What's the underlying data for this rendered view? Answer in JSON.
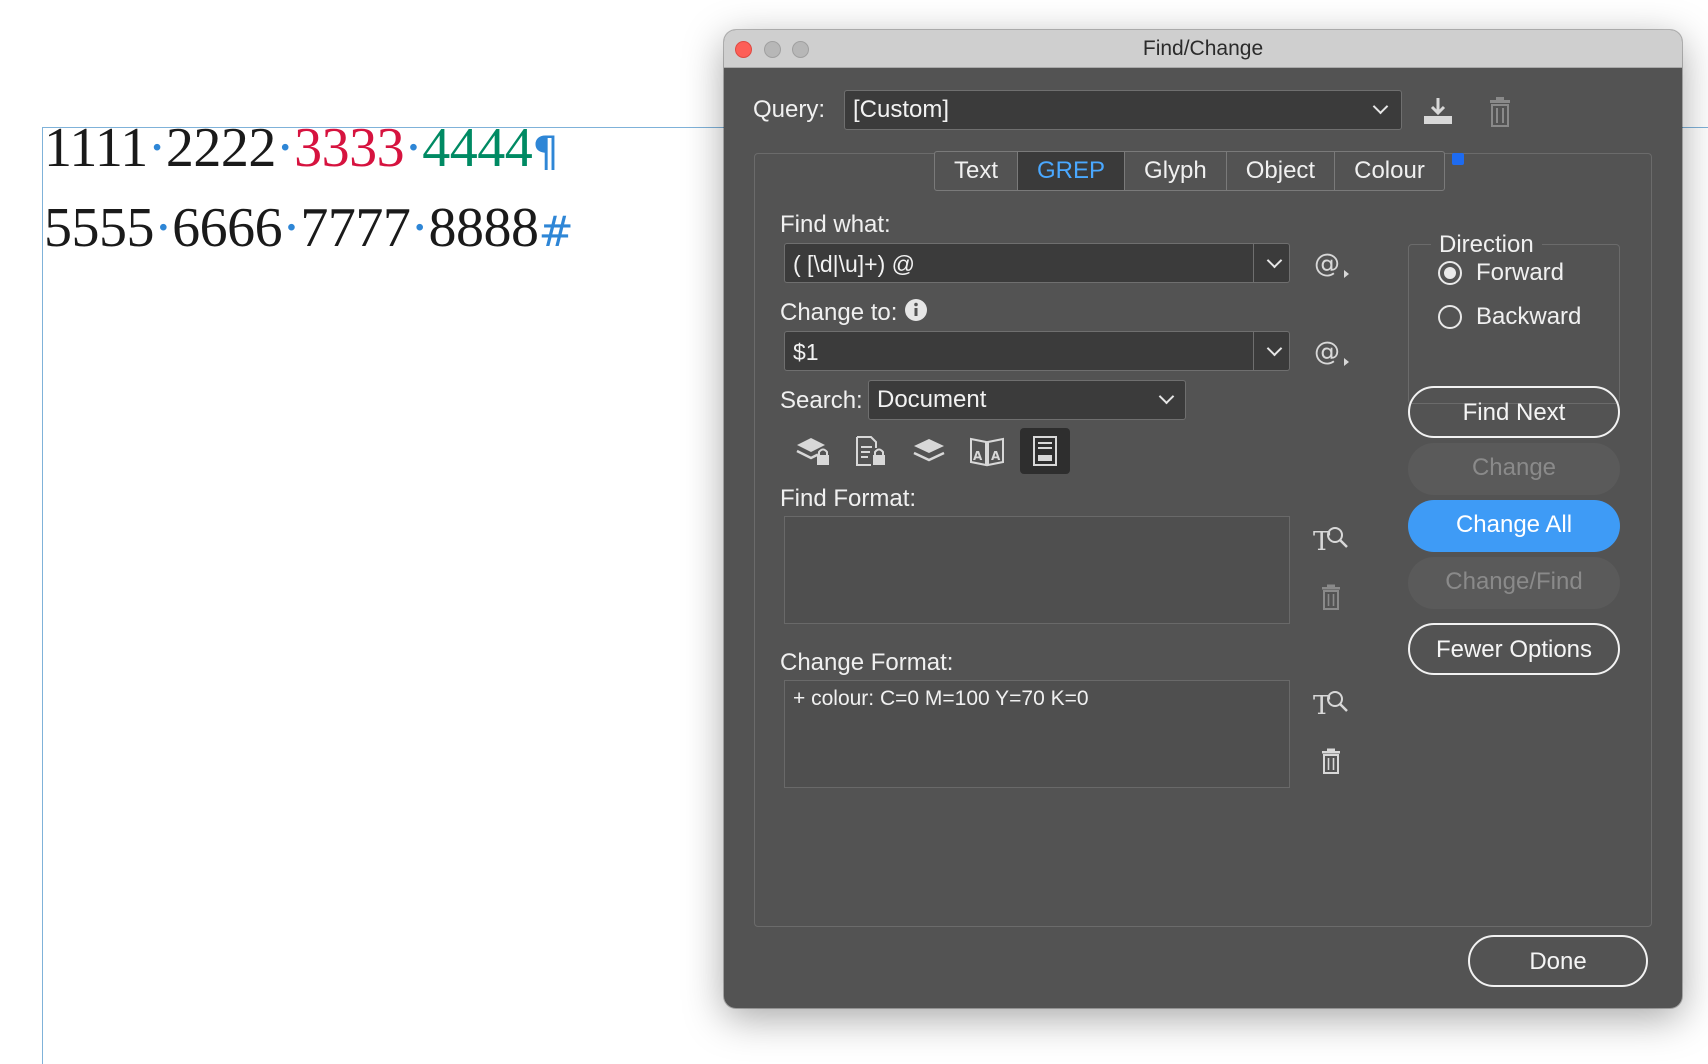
{
  "document": {
    "line1": {
      "n1": "1111",
      "n2": "2222",
      "n3": "3333",
      "n4": "4444",
      "dot": "·",
      "end_mark": "¶"
    },
    "line2": {
      "n1": "5555",
      "n2": "6666",
      "n3": "7777",
      "n4": "8888",
      "dot": "·",
      "end_mark": "#"
    },
    "colors": {
      "red_text": "#d6133f",
      "green_text": "#008a63",
      "hidden_chars": "#2e86d6"
    }
  },
  "dialog": {
    "title": "Find/Change",
    "query": {
      "label": "Query:",
      "value": "[Custom]"
    },
    "tabs": [
      {
        "label": "Text"
      },
      {
        "label": "GREP",
        "active": true
      },
      {
        "label": "Glyph"
      },
      {
        "label": "Object"
      },
      {
        "label": "Colour"
      }
    ],
    "find_what": {
      "label": "Find what:",
      "value": "( [\\d|\\u]+) @"
    },
    "change_to": {
      "label": "Change to:",
      "value": "$1"
    },
    "search": {
      "label": "Search:",
      "value": "Document"
    },
    "find_format": {
      "label": "Find Format:",
      "value": ""
    },
    "change_format": {
      "label": "Change Format:",
      "value": "+ colour: C=0 M=100 Y=70 K=0"
    },
    "direction": {
      "title": "Direction",
      "options": [
        {
          "label": "Forward",
          "selected": true
        },
        {
          "label": "Backward",
          "selected": false
        }
      ]
    },
    "buttons": {
      "find_next": "Find Next",
      "change": "Change",
      "change_all": "Change All",
      "change_find": "Change/Find",
      "fewer_options": "Fewer Options",
      "done": "Done"
    },
    "accent_color": "#3e9bf6",
    "icons": {
      "query_save": "save-query-icon",
      "query_delete": "trash-icon",
      "special_chars": "at-sign-menu-icon",
      "info": "info-icon",
      "search_options": [
        "include-locked-layers-icon",
        "include-locked-stories-icon",
        "include-hidden-layers-icon",
        "include-master-pages-icon",
        "include-footnotes-icon"
      ],
      "format": "type-magnifier-icon"
    }
  }
}
